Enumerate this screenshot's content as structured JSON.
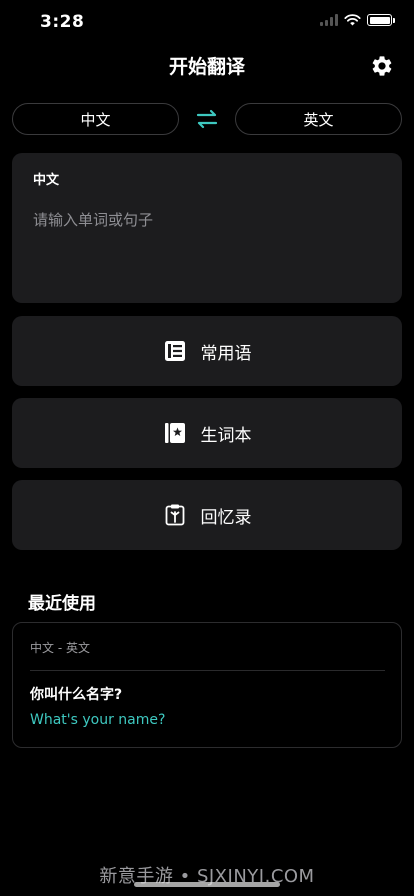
{
  "status_bar": {
    "time": "3:28"
  },
  "header": {
    "title": "开始翻译"
  },
  "languages": {
    "source": "中文",
    "target": "英文"
  },
  "input": {
    "lang_label": "中文",
    "placeholder": "请输入单词或句子"
  },
  "menu": [
    {
      "label": "常用语",
      "icon": "phrasebook-icon"
    },
    {
      "label": "生词本",
      "icon": "vocabulary-book-icon"
    },
    {
      "label": "回忆录",
      "icon": "memoir-icon"
    }
  ],
  "recent": {
    "title": "最近使用",
    "items": [
      {
        "pair": "中文 - 英文",
        "source": "你叫什么名字?",
        "result": "What's your name?"
      }
    ]
  },
  "watermark": "新意手游 • SJXINYI.COM",
  "colors": {
    "accent": "#3ec8c0",
    "card": "#1c1c1e",
    "background": "#000000"
  }
}
